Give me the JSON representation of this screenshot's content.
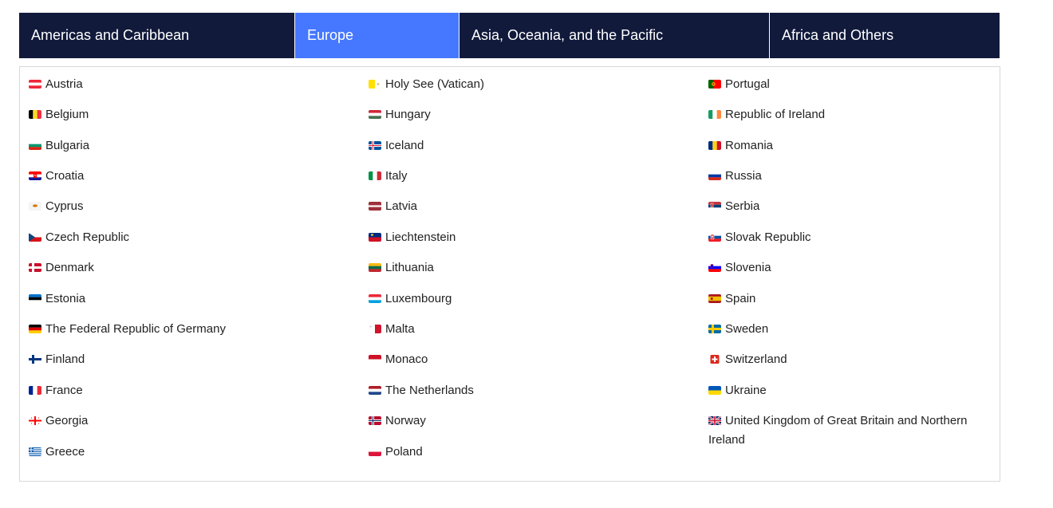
{
  "tabs": [
    {
      "label": "Americas and Caribbean",
      "active": false
    },
    {
      "label": "Europe",
      "active": true
    },
    {
      "label": "Asia, Oceania, and the Pacific",
      "active": false
    },
    {
      "label": "Africa and Others",
      "active": false
    }
  ],
  "countries": {
    "col1": [
      {
        "name": "Austria",
        "flag": "austria-flag"
      },
      {
        "name": "Belgium",
        "flag": "belgium-flag"
      },
      {
        "name": "Bulgaria",
        "flag": "bulgaria-flag"
      },
      {
        "name": "Croatia",
        "flag": "croatia-flag"
      },
      {
        "name": "Cyprus",
        "flag": "cyprus-flag"
      },
      {
        "name": "Czech Republic",
        "flag": "czech-flag"
      },
      {
        "name": "Denmark",
        "flag": "denmark-flag"
      },
      {
        "name": "Estonia",
        "flag": "estonia-flag"
      },
      {
        "name": "The Federal Republic of Germany",
        "flag": "germany-flag"
      },
      {
        "name": "Finland",
        "flag": "finland-flag"
      },
      {
        "name": "France",
        "flag": "france-flag"
      },
      {
        "name": "Georgia",
        "flag": "georgia-flag"
      },
      {
        "name": "Greece",
        "flag": "greece-flag"
      }
    ],
    "col2": [
      {
        "name": "Holy See (Vatican)",
        "flag": "vatican-flag"
      },
      {
        "name": "Hungary",
        "flag": "hungary-flag"
      },
      {
        "name": "Iceland",
        "flag": "iceland-flag"
      },
      {
        "name": "Italy",
        "flag": "italy-flag"
      },
      {
        "name": "Latvia",
        "flag": "latvia-flag"
      },
      {
        "name": "Liechtenstein",
        "flag": "liechtenstein-flag"
      },
      {
        "name": "Lithuania",
        "flag": "lithuania-flag"
      },
      {
        "name": "Luxembourg",
        "flag": "luxembourg-flag"
      },
      {
        "name": "Malta",
        "flag": "malta-flag"
      },
      {
        "name": "Monaco",
        "flag": "monaco-flag"
      },
      {
        "name": "The Netherlands",
        "flag": "netherlands-flag"
      },
      {
        "name": "Norway",
        "flag": "norway-flag"
      },
      {
        "name": "Poland",
        "flag": "poland-flag"
      }
    ],
    "col3": [
      {
        "name": "Portugal",
        "flag": "portugal-flag"
      },
      {
        "name": "Republic of Ireland",
        "flag": "ireland-flag"
      },
      {
        "name": "Romania",
        "flag": "romania-flag"
      },
      {
        "name": "Russia",
        "flag": "russia-flag"
      },
      {
        "name": "Serbia",
        "flag": "serbia-flag"
      },
      {
        "name": "Slovak Republic",
        "flag": "slovakia-flag"
      },
      {
        "name": "Slovenia",
        "flag": "slovenia-flag"
      },
      {
        "name": "Spain",
        "flag": "spain-flag"
      },
      {
        "name": "Sweden",
        "flag": "sweden-flag"
      },
      {
        "name": "Switzerland",
        "flag": "switzerland-flag"
      },
      {
        "name": "Ukraine",
        "flag": "ukraine-flag"
      },
      {
        "name": "United Kingdom of Great Britain and Northern Ireland",
        "flag": "uk-flag"
      }
    ]
  }
}
